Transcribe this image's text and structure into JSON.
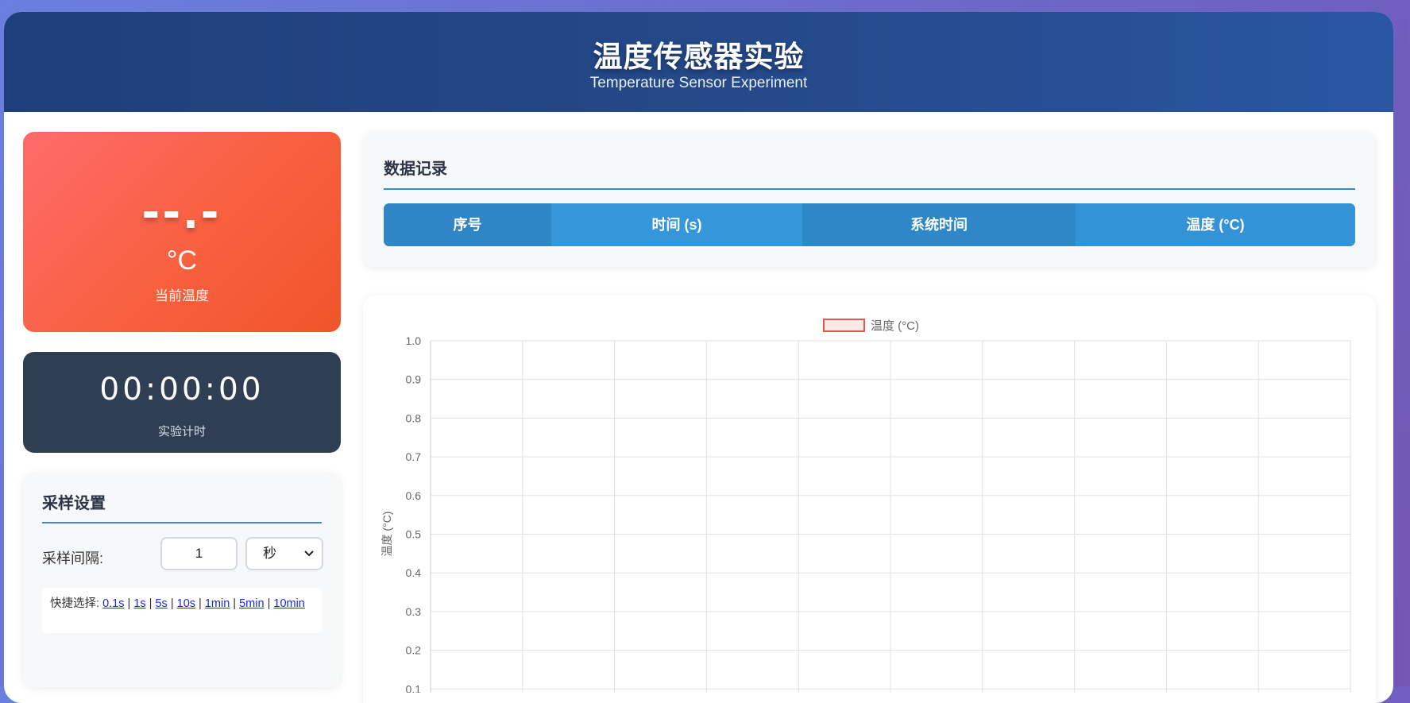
{
  "header": {
    "title": "温度传感器实验",
    "subtitle": "Temperature Sensor Experiment"
  },
  "current": {
    "value": "--.-",
    "unit": "°C",
    "label": "当前温度"
  },
  "timer": {
    "value": "00:00:00",
    "label": "实验计时"
  },
  "sampling": {
    "title": "采样设置",
    "interval_label": "采样间隔:",
    "interval_value": "1",
    "unit_selected": "秒",
    "quick_label": "快捷选择:",
    "quick_options": [
      "0.1s",
      "1s",
      "5s",
      "10s",
      "1min",
      "5min",
      "10min"
    ]
  },
  "records": {
    "title": "数据记录",
    "columns": [
      "序号",
      "时间 (s)",
      "系统时间",
      "温度 (°C)"
    ]
  },
  "colors": {
    "accent": "#3a8ad0",
    "series": "#e8574e"
  },
  "chart_data": {
    "type": "line",
    "series": [
      {
        "name": "温度 (°C)",
        "values": []
      }
    ],
    "ylabel": "温度 (°C)",
    "xlabel": "",
    "ylim": [
      0,
      1.0
    ],
    "yticks": [
      "1.0",
      "0.9",
      "0.8",
      "0.7",
      "0.6",
      "0.5",
      "0.4",
      "0.3",
      "0.2",
      "0.1"
    ],
    "grid": true,
    "legend": "top-center"
  }
}
